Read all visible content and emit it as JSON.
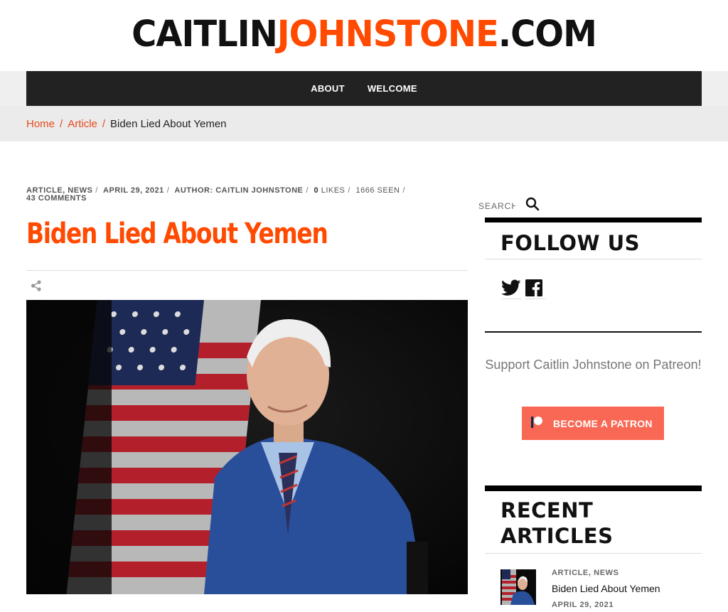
{
  "logo": {
    "part1": "CAITLIN",
    "part2": "JOHNSTONE",
    "part3": ".COM"
  },
  "nav": {
    "items": [
      "ABOUT",
      "WELCOME"
    ]
  },
  "breadcrumb": {
    "home": "Home",
    "section": "Article",
    "sep": "/",
    "current": "Biden Lied About Yemen"
  },
  "article": {
    "categories": [
      "ARTICLE",
      "NEWS"
    ],
    "date": "APRIL 29, 2021",
    "author": "AUTHOR: CAITLIN JOHNSTONE",
    "likes_count": "0",
    "likes_label": "LIKES",
    "seen": "1666 SEEN",
    "comments": "43 COMMENTS",
    "title": "Biden Lied About Yemen"
  },
  "sidebar": {
    "search_placeholder": "SEARCH",
    "follow_title": "FOLLOW US",
    "support_text": "Support Caitlin Johnstone on Patreon!",
    "patron_button": "BECOME A PATRON",
    "recent_title_line1": "RECENT",
    "recent_title_line2": "ARTICLES",
    "recent": [
      {
        "categories": "ARTICLE, NEWS",
        "title": "Biden Lied About Yemen",
        "date": "APRIL 29, 2021"
      }
    ]
  },
  "colors": {
    "accent": "#ff4a00",
    "nav_bg": "#222222",
    "patreon": "#f96854"
  },
  "icons": [
    "share-icon",
    "search-icon",
    "twitter-icon",
    "facebook-icon",
    "patreon-icon"
  ]
}
